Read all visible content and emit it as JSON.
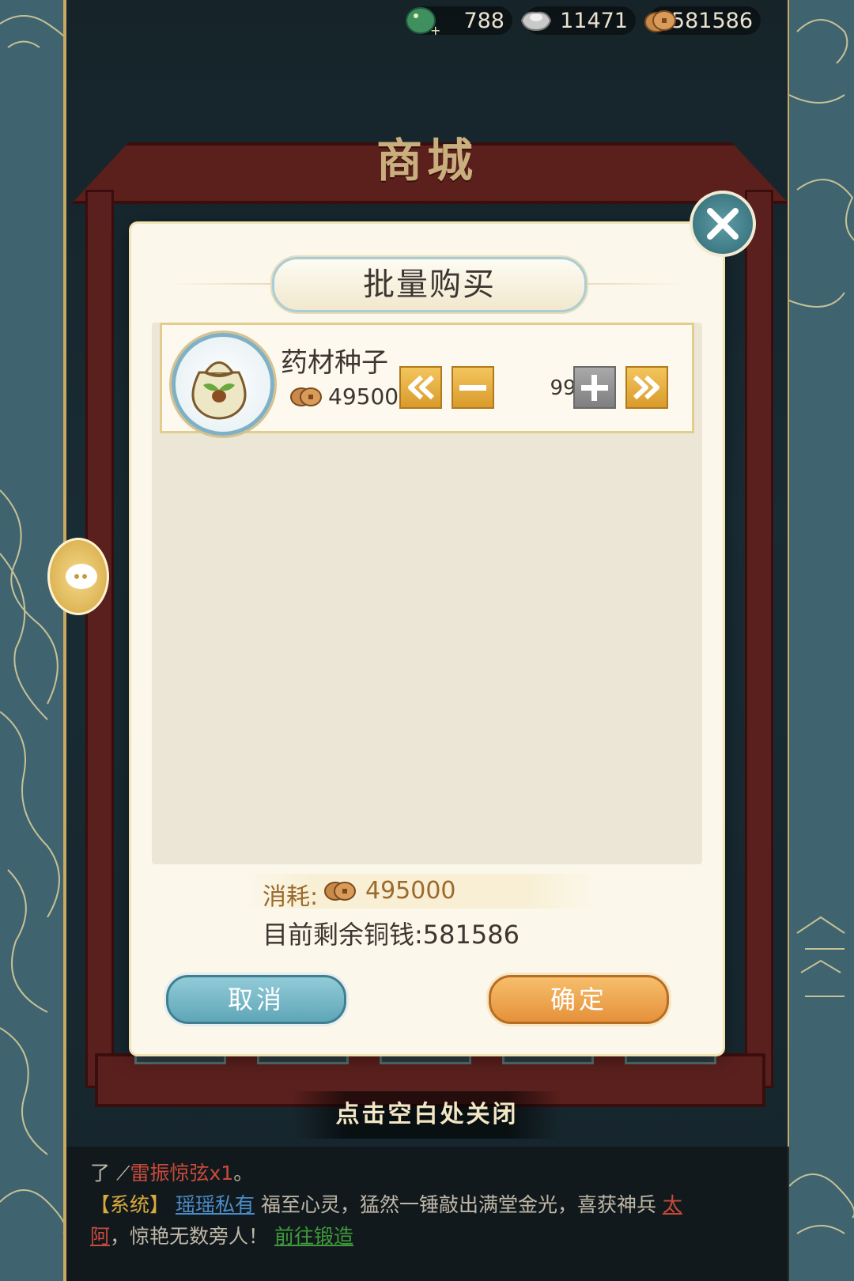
{
  "currency": {
    "jade": "788",
    "silver": "11471",
    "copper": "581586"
  },
  "shop": {
    "title": "商城",
    "close_hint": "点击空白处关闭"
  },
  "dialog": {
    "title": "批量购买",
    "item": {
      "name": "药材种子",
      "price": "495000",
      "quantity": "99"
    },
    "cost_label": "消耗:",
    "cost_value": "495000",
    "remaining_label": "目前剩余铜钱:",
    "remaining_value": "581586",
    "cancel_label": "取消",
    "confirm_label": "确定"
  },
  "chat": {
    "line1_prefix": "了",
    "line1_item": "雷振惊弦x1",
    "line1_suffix": "。",
    "system_tag": "【系统】",
    "player_name": "瑶瑶私有",
    "message": "福至心灵，猛然一锤敲出满堂金光，喜获神兵",
    "weapon_name_a": "太",
    "weapon_name_b": "阿",
    "message_tail": "，惊艳无数旁人！",
    "link_label": "前往锻造"
  },
  "colors": {
    "dialog_bg": "#fbf7ea",
    "cancel_button": "#5fa6b8",
    "confirm_button": "#e6913b",
    "cost_text": "#9b6a2c"
  }
}
